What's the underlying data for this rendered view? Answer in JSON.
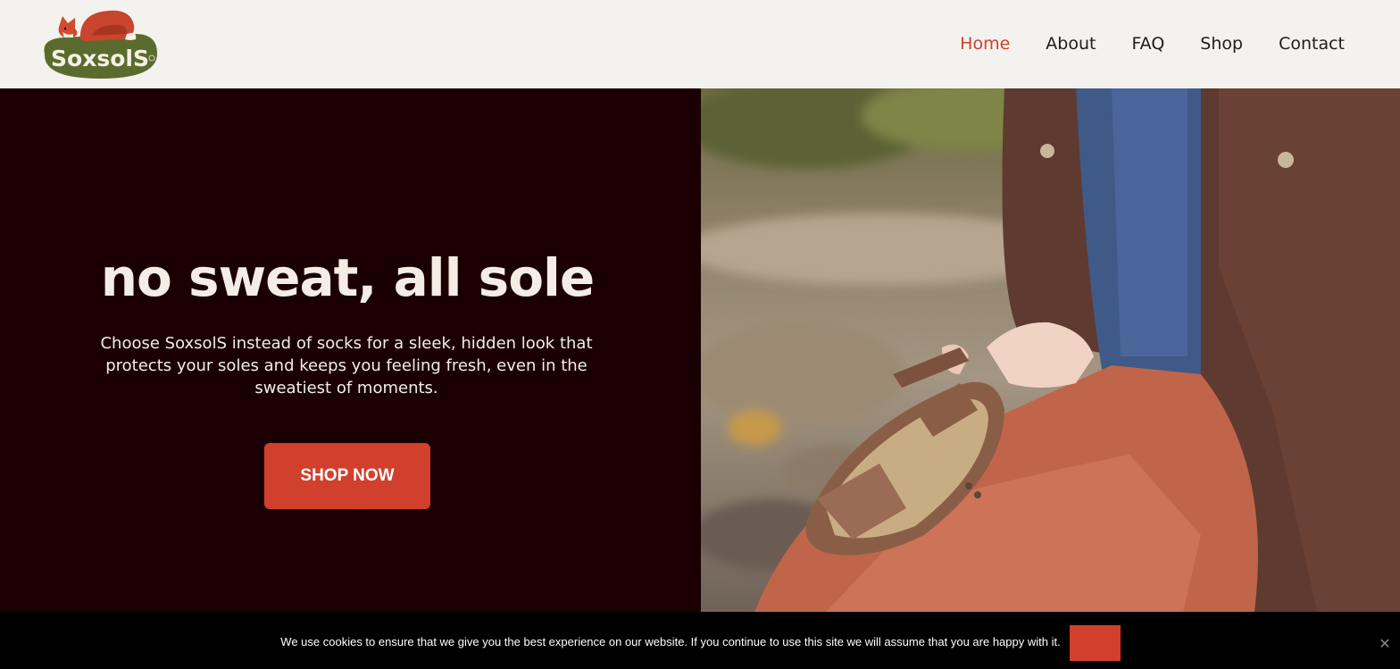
{
  "header": {
    "logo_text": "SoxsolS",
    "nav": [
      {
        "label": "Home",
        "active": true
      },
      {
        "label": "About",
        "active": false
      },
      {
        "label": "FAQ",
        "active": false
      },
      {
        "label": "Shop",
        "active": false
      },
      {
        "label": "Contact",
        "active": false
      }
    ]
  },
  "hero": {
    "title": "no sweat, all sole",
    "description": "Choose SoxsolS instead of socks for a sleek, hidden look that protects your soles and keeps you feeling fresh, even in the sweatiest of moments.",
    "cta_label": "SHOP NOW",
    "image_subject": "person-holding-sandal-with-insole"
  },
  "cookie_notice": {
    "text": "We use cookies to ensure that we give you the best experience on our website. If you continue to use this site we will assume that you are happy with it.",
    "accept_label": "",
    "close_icon": "close-icon"
  },
  "colors": {
    "accent": "#d0402c",
    "hero_bg": "#1a0003",
    "header_bg": "#f3f2ee",
    "logo_green": "#5b6b2e"
  }
}
